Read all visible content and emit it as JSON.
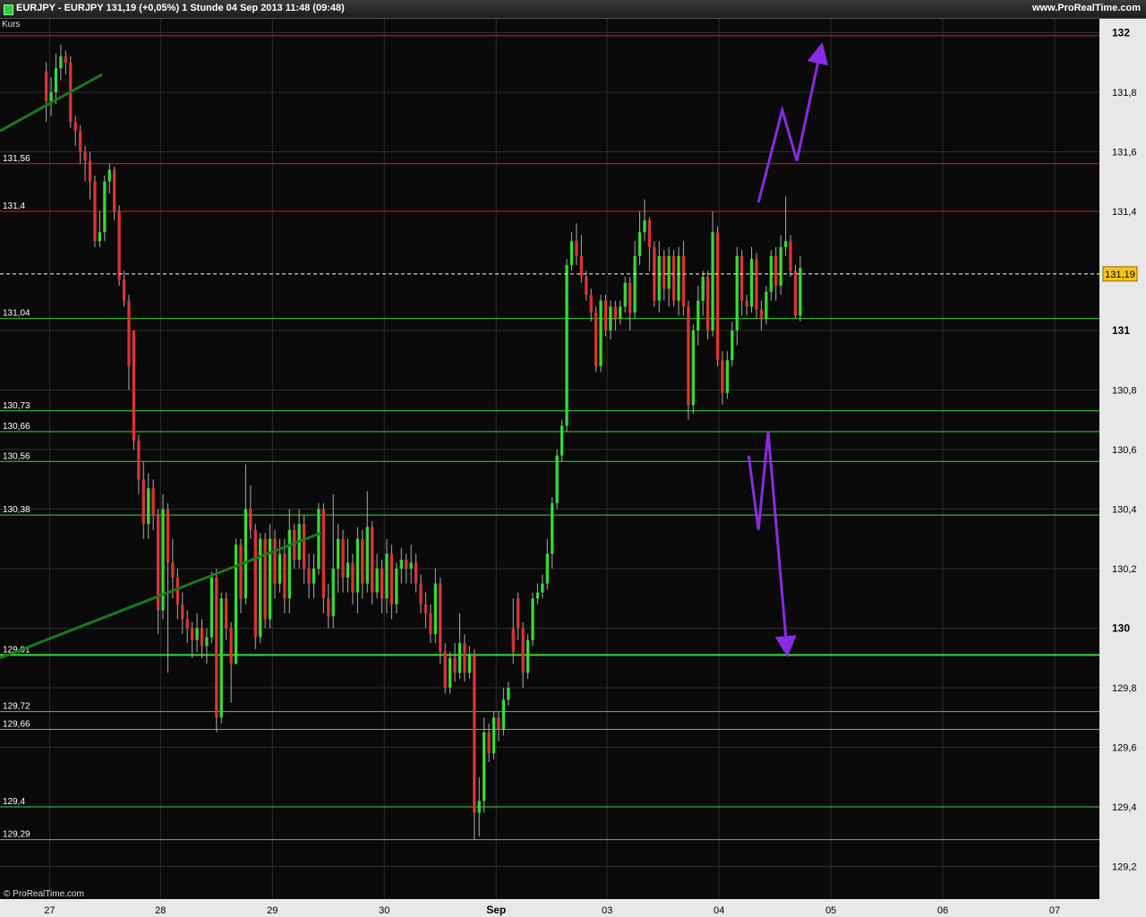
{
  "header": {
    "title": "EURJPY - EURJPY    131,19 (+0,05%)    1 Stunde  04 Sep 2013 11:48 (09:48)",
    "brand": "www.ProRealTime.com",
    "series_label": "Kurs",
    "copyright": "© ProRealTime.com"
  },
  "colors": {
    "background": "#0a0a0a",
    "grid": "#2e2e2e",
    "bull": "#33dd33",
    "bear": "#dd3333",
    "resistance": "#cc2222",
    "support": "#33dd33",
    "trendline": "#1a7a1a",
    "projection": "#8a2be2",
    "current_price": "#f5c518"
  },
  "chart_data": {
    "type": "candlestick",
    "instrument": "EURJPY",
    "timeframe": "1 Stunde",
    "ylim": [
      129.1,
      132.1
    ],
    "y_ticks": [
      {
        "v": 132,
        "label": "132",
        "bold": true
      },
      {
        "v": 131.8,
        "label": "131,8"
      },
      {
        "v": 131.6,
        "label": "131,6"
      },
      {
        "v": 131.4,
        "label": "131,4"
      },
      {
        "v": 131,
        "label": "131",
        "bold": true
      },
      {
        "v": 130.8,
        "label": "130,8"
      },
      {
        "v": 130.6,
        "label": "130,6"
      },
      {
        "v": 130.4,
        "label": "130,4"
      },
      {
        "v": 130.2,
        "label": "130,2"
      },
      {
        "v": 130,
        "label": "130",
        "bold": true
      },
      {
        "v": 129.8,
        "label": "129,8"
      },
      {
        "v": 129.6,
        "label": "129,6"
      },
      {
        "v": 129.4,
        "label": "129,4"
      },
      {
        "v": 129.2,
        "label": "129,2"
      }
    ],
    "x_ticks": [
      {
        "t": 0.7,
        "label": "27"
      },
      {
        "t": 23.5,
        "label": "28"
      },
      {
        "t": 46.5,
        "label": "29"
      },
      {
        "t": 69.5,
        "label": "30"
      },
      {
        "t": 92.5,
        "label": "Sep",
        "bold": true
      },
      {
        "t": 115.3,
        "label": "03"
      },
      {
        "t": 138.3,
        "label": "04"
      },
      {
        "t": 161.3,
        "label": "05"
      },
      {
        "t": 184.3,
        "label": "06"
      },
      {
        "t": 207.3,
        "label": "07"
      }
    ],
    "x_range": [
      -9.5,
      216.5
    ],
    "levels": [
      {
        "v": 131.99,
        "label": "",
        "type": "resistance"
      },
      {
        "v": 131.56,
        "label": "131,56",
        "type": "resistance"
      },
      {
        "v": 131.4,
        "label": "131,4",
        "type": "resistance"
      },
      {
        "v": 131.04,
        "label": "131,04",
        "type": "support"
      },
      {
        "v": 130.73,
        "label": "130,73",
        "type": "support"
      },
      {
        "v": 130.66,
        "label": "130,66",
        "type": "support"
      },
      {
        "v": 130.56,
        "label": "130,56",
        "type": "support"
      },
      {
        "v": 130.38,
        "label": "130,38",
        "type": "support"
      },
      {
        "v": 129.91,
        "label": "129,91",
        "type": "support",
        "bold": true
      },
      {
        "v": 129.72,
        "label": "129,72",
        "type": "support"
      },
      {
        "v": 129.66,
        "label": "129,66",
        "type": "support"
      },
      {
        "v": 129.4,
        "label": "129,4",
        "type": "support"
      },
      {
        "v": 129.29,
        "label": "129,29",
        "type": "support"
      }
    ],
    "current_price": {
      "v": 131.19,
      "label": "131,19"
    },
    "trendlines": [
      {
        "from": [
          -9.5,
          131.67
        ],
        "to": [
          11.5,
          131.86
        ]
      },
      {
        "from": [
          -9.5,
          129.9
        ],
        "to": [
          56.5,
          130.32
        ]
      }
    ],
    "projections": [
      [
        [
          146.4,
          131.43
        ],
        [
          151.3,
          131.74
        ],
        [
          154.3,
          131.57
        ],
        [
          159.3,
          131.95
        ]
      ],
      [
        [
          144.4,
          130.58
        ],
        [
          146.4,
          130.33
        ],
        [
          148.4,
          130.66
        ],
        [
          152.3,
          129.92
        ]
      ]
    ],
    "candles": [
      [
        131.87,
        131.77,
        131.9,
        131.7
      ],
      [
        131.77,
        131.8,
        131.85,
        131.72
      ],
      [
        131.8,
        131.88,
        131.93,
        131.76
      ],
      [
        131.88,
        131.92,
        131.96,
        131.84
      ],
      [
        131.92,
        131.9,
        131.94,
        131.86
      ],
      [
        131.9,
        131.7,
        131.92,
        131.68
      ],
      [
        131.7,
        131.67,
        131.72,
        131.62
      ],
      [
        131.67,
        131.6,
        131.69,
        131.56
      ],
      [
        131.6,
        131.57,
        131.62,
        131.5
      ],
      [
        131.57,
        131.5,
        131.6,
        131.44
      ],
      [
        131.5,
        131.3,
        131.52,
        131.28
      ],
      [
        131.3,
        131.33,
        131.4,
        131.28
      ],
      [
        131.33,
        131.5,
        131.52,
        131.3
      ],
      [
        131.5,
        131.54,
        131.56,
        131.46
      ],
      [
        131.54,
        131.4,
        131.55,
        131.37
      ],
      [
        131.4,
        131.17,
        131.42,
        131.15
      ],
      [
        131.17,
        131.1,
        131.2,
        131.08
      ],
      [
        131.1,
        130.88,
        131.12,
        130.8
      ],
      [
        131.0,
        130.63,
        130.92,
        130.6
      ],
      [
        130.63,
        130.5,
        130.65,
        130.45
      ],
      [
        130.5,
        130.35,
        130.56,
        130.3
      ],
      [
        130.35,
        130.47,
        130.52,
        130.3
      ],
      [
        130.47,
        130.38,
        130.5,
        130.33
      ],
      [
        130.38,
        130.06,
        130.4,
        129.98
      ],
      [
        130.06,
        130.4,
        130.45,
        130.03
      ],
      [
        130.4,
        130.22,
        130.42,
        129.85
      ],
      [
        130.22,
        130.17,
        130.3,
        130.1
      ],
      [
        130.17,
        130.08,
        130.2,
        130.03
      ],
      [
        130.08,
        130.03,
        130.12,
        129.98
      ],
      [
        130.03,
        130.0,
        130.06,
        129.95
      ],
      [
        130.0,
        129.96,
        130.02,
        129.9
      ],
      [
        129.96,
        130.0,
        130.05,
        129.92
      ],
      [
        130.0,
        129.94,
        130.03,
        129.9
      ],
      [
        129.94,
        129.97,
        130.0,
        129.88
      ],
      [
        129.97,
        130.17,
        130.19,
        129.95
      ],
      [
        130.17,
        129.7,
        130.2,
        129.65
      ],
      [
        129.7,
        130.1,
        130.12,
        129.68
      ],
      [
        130.1,
        130.0,
        130.12,
        129.96
      ],
      [
        130.0,
        129.88,
        130.02,
        129.75
      ],
      [
        129.88,
        130.28,
        130.3,
        129.88
      ],
      [
        130.28,
        130.1,
        130.3,
        130.05
      ],
      [
        130.1,
        130.4,
        130.55,
        130.08
      ],
      [
        130.4,
        130.33,
        130.48,
        130.3
      ],
      [
        130.33,
        129.97,
        130.35,
        129.93
      ],
      [
        129.97,
        130.3,
        130.32,
        129.95
      ],
      [
        130.3,
        130.03,
        130.32,
        130.0
      ],
      [
        130.03,
        130.3,
        130.35,
        130.0
      ],
      [
        130.3,
        130.15,
        130.33,
        130.1
      ],
      [
        130.15,
        130.25,
        130.3,
        130.12
      ],
      [
        130.25,
        130.1,
        130.3,
        130.05
      ],
      [
        130.1,
        130.33,
        130.4,
        130.05
      ],
      [
        130.33,
        130.23,
        130.35,
        130.2
      ],
      [
        130.23,
        130.35,
        130.4,
        130.2
      ],
      [
        130.35,
        130.2,
        130.38,
        130.15
      ],
      [
        130.2,
        130.15,
        130.25,
        130.1
      ],
      [
        130.15,
        130.2,
        130.25,
        130.1
      ],
      [
        130.2,
        130.4,
        130.42,
        130.18
      ],
      [
        130.4,
        130.1,
        130.42,
        130.05
      ],
      [
        130.1,
        130.04,
        130.15,
        130.0
      ],
      [
        130.04,
        130.2,
        130.45,
        130.0
      ],
      [
        130.2,
        130.3,
        130.35,
        130.12
      ],
      [
        130.3,
        130.17,
        130.33,
        130.12
      ],
      [
        130.17,
        130.22,
        130.3,
        130.12
      ],
      [
        130.22,
        130.12,
        130.25,
        130.08
      ],
      [
        130.12,
        130.3,
        130.34,
        130.05
      ],
      [
        130.3,
        130.15,
        130.33,
        130.1
      ],
      [
        130.15,
        130.34,
        130.46,
        130.12
      ],
      [
        130.34,
        130.12,
        130.36,
        130.08
      ],
      [
        130.12,
        130.2,
        130.25,
        130.1
      ],
      [
        130.2,
        130.1,
        130.23,
        130.05
      ],
      [
        130.1,
        130.25,
        130.3,
        130.05
      ],
      [
        130.25,
        130.08,
        130.28,
        130.03
      ],
      [
        130.08,
        130.2,
        130.22,
        130.05
      ],
      [
        130.2,
        130.23,
        130.27,
        130.15
      ],
      [
        130.23,
        130.2,
        130.25,
        130.15
      ],
      [
        130.2,
        130.22,
        130.28,
        130.15
      ],
      [
        130.22,
        130.15,
        130.25,
        130.12
      ],
      [
        130.15,
        130.08,
        130.18,
        130.05
      ],
      [
        130.08,
        130.05,
        130.12,
        130.0
      ],
      [
        130.05,
        129.98,
        130.08,
        129.95
      ],
      [
        129.98,
        130.15,
        130.2,
        129.95
      ],
      [
        130.15,
        129.92,
        130.17,
        129.88
      ],
      [
        129.92,
        129.8,
        129.95,
        129.78
      ],
      [
        129.8,
        129.9,
        129.92,
        129.78
      ],
      [
        129.9,
        129.85,
        129.95,
        129.82
      ],
      [
        129.85,
        129.95,
        130.05,
        129.83
      ],
      [
        129.95,
        129.85,
        129.98,
        129.82
      ],
      [
        129.85,
        129.91,
        129.94,
        129.83
      ],
      [
        129.91,
        129.38,
        129.93,
        129.29
      ],
      [
        129.38,
        129.42,
        129.5,
        129.3
      ],
      [
        129.42,
        129.65,
        129.7,
        129.38
      ],
      [
        129.65,
        129.58,
        129.68,
        129.55
      ],
      [
        129.58,
        129.7,
        129.72,
        129.56
      ],
      [
        129.7,
        129.66,
        129.72,
        129.62
      ],
      [
        129.66,
        129.76,
        129.8,
        129.64
      ],
      [
        129.76,
        129.8,
        129.82,
        129.74
      ],
      [
        130.0,
        129.92,
        130.1,
        129.88
      ],
      [
        130.1,
        130.0,
        130.12,
        129.96
      ],
      [
        130.0,
        129.85,
        130.02,
        129.8
      ],
      [
        129.85,
        129.96,
        129.98,
        129.83
      ],
      [
        129.96,
        130.1,
        130.12,
        129.94
      ],
      [
        130.1,
        130.12,
        130.15,
        130.08
      ],
      [
        130.12,
        130.15,
        130.18,
        130.1
      ],
      [
        130.15,
        130.25,
        130.3,
        130.13
      ],
      [
        130.25,
        130.42,
        130.44,
        130.2
      ],
      [
        130.42,
        130.58,
        130.6,
        130.4
      ],
      [
        130.58,
        130.68,
        130.7,
        130.56
      ],
      [
        130.68,
        131.22,
        131.24,
        130.66
      ],
      [
        131.22,
        131.3,
        131.33,
        131.2
      ],
      [
        131.3,
        131.25,
        131.36,
        131.22
      ],
      [
        131.25,
        131.18,
        131.32,
        131.16
      ],
      [
        131.18,
        131.12,
        131.2,
        131.1
      ],
      [
        131.12,
        131.06,
        131.14,
        131.03
      ],
      [
        131.06,
        130.88,
        131.08,
        130.86
      ],
      [
        130.88,
        131.1,
        131.12,
        130.86
      ],
      [
        131.1,
        131.0,
        131.12,
        130.98
      ],
      [
        131.0,
        131.08,
        131.1,
        130.97
      ],
      [
        131.08,
        131.04,
        131.1,
        131.0
      ],
      [
        131.04,
        131.08,
        131.1,
        131.02
      ],
      [
        131.08,
        131.16,
        131.18,
        131.06
      ],
      [
        131.16,
        131.06,
        131.18,
        131.0
      ],
      [
        131.06,
        131.25,
        131.3,
        131.04
      ],
      [
        131.25,
        131.33,
        131.4,
        131.22
      ],
      [
        131.33,
        131.37,
        131.44,
        131.3
      ],
      [
        131.37,
        131.28,
        131.38,
        131.2
      ],
      [
        131.28,
        131.1,
        131.3,
        131.08
      ],
      [
        131.1,
        131.25,
        131.3,
        131.06
      ],
      [
        131.25,
        131.14,
        131.27,
        131.1
      ],
      [
        131.14,
        131.25,
        131.28,
        131.08
      ],
      [
        131.25,
        131.1,
        131.27,
        131.08
      ],
      [
        131.1,
        131.25,
        131.28,
        131.05
      ],
      [
        131.25,
        131.08,
        131.3,
        131.05
      ],
      [
        131.08,
        130.75,
        131.1,
        130.7
      ],
      [
        130.75,
        131.0,
        131.02,
        130.72
      ],
      [
        131.0,
        131.1,
        131.15,
        130.95
      ],
      [
        131.1,
        131.18,
        131.2,
        131.05
      ],
      [
        131.18,
        131.0,
        131.2,
        130.97
      ],
      [
        131.0,
        131.33,
        131.4,
        130.98
      ],
      [
        131.33,
        130.9,
        131.35,
        130.88
      ],
      [
        130.9,
        130.79,
        130.93,
        130.75
      ],
      [
        130.79,
        130.9,
        130.93,
        130.77
      ],
      [
        130.9,
        131.0,
        131.03,
        130.88
      ],
      [
        131.0,
        131.25,
        131.28,
        130.95
      ],
      [
        131.25,
        131.1,
        131.27,
        131.05
      ],
      [
        131.1,
        131.08,
        131.12,
        131.05
      ],
      [
        131.08,
        131.24,
        131.28,
        131.06
      ],
      [
        131.24,
        131.07,
        131.26,
        131.04
      ],
      [
        131.07,
        131.04,
        131.1,
        131.0
      ],
      [
        131.04,
        131.13,
        131.15,
        131.02
      ],
      [
        131.13,
        131.25,
        131.27,
        131.1
      ],
      [
        131.25,
        131.15,
        131.28,
        131.1
      ],
      [
        131.15,
        131.28,
        131.32,
        131.12
      ],
      [
        131.28,
        131.3,
        131.45,
        131.25
      ],
      [
        131.3,
        131.2,
        131.32,
        131.18
      ],
      [
        131.2,
        131.05,
        131.22,
        131.04
      ],
      [
        131.05,
        131.21,
        131.25,
        131.03
      ]
    ]
  }
}
